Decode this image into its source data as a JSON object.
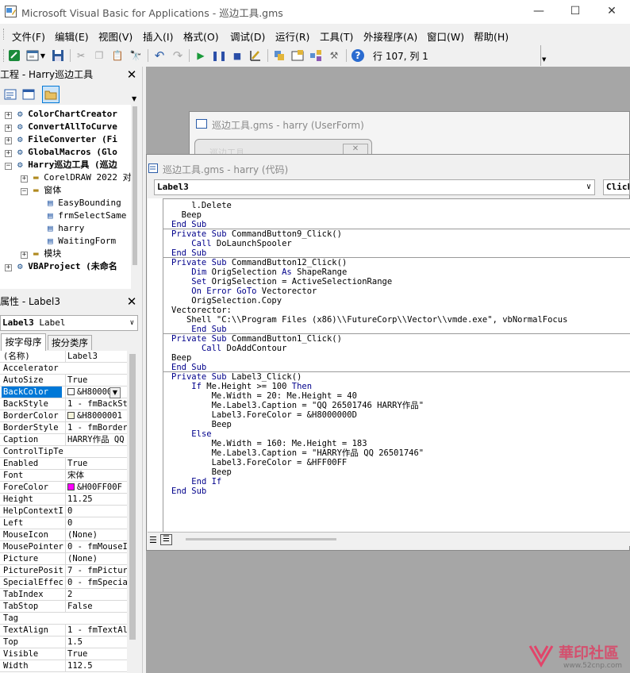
{
  "window": {
    "title": "Microsoft Visual Basic for Applications - 巡边工具.gms",
    "minimize": "—",
    "maximize": "☐",
    "close": "✕"
  },
  "menu": [
    "文件(F)",
    "编辑(E)",
    "视图(V)",
    "插入(I)",
    "格式(O)",
    "调试(D)",
    "运行(R)",
    "工具(T)",
    "外接程序(A)",
    "窗口(W)",
    "帮助(H)"
  ],
  "toolbar": {
    "position": "行 107, 列 1"
  },
  "project_panel": {
    "title": "工程 - Harry巡边工具",
    "items": [
      {
        "text": "ColorChartCreator",
        "bold": true
      },
      {
        "text": "ConvertAllToCurve",
        "bold": true
      },
      {
        "text": "FileConverter (Fi",
        "bold": true
      },
      {
        "text": "GlobalMacros (Glo",
        "bold": true
      },
      {
        "text": "Harry巡边工具 (巡边",
        "bold": true
      },
      {
        "text": "CorelDRAW 2022 对",
        "bold": false
      },
      {
        "text": "窗体",
        "bold": false
      },
      {
        "text": "EasyBounding",
        "bold": false
      },
      {
        "text": "frmSelectSame",
        "bold": false
      },
      {
        "text": "harry",
        "bold": false
      },
      {
        "text": "WaitingForm",
        "bold": false
      },
      {
        "text": "模块",
        "bold": false
      },
      {
        "text": "VBAProject (未命名",
        "bold": true
      }
    ]
  },
  "properties_panel": {
    "title": "属性 - Label3",
    "object": "Label3",
    "object_type": "Label",
    "tabs": [
      "按字母序",
      "按分类序"
    ],
    "rows": [
      {
        "name": "(名称)",
        "value": "Label3"
      },
      {
        "name": "Accelerator",
        "value": ""
      },
      {
        "name": "AutoSize",
        "value": "True"
      },
      {
        "name": "BackColor",
        "value": "&H80000",
        "swatch": "#ffffff"
      },
      {
        "name": "BackStyle",
        "value": "1 - fmBackSt"
      },
      {
        "name": "BorderColor",
        "value": "&H8000001",
        "swatch": "#f5f5dc"
      },
      {
        "name": "BorderStyle",
        "value": "1 - fmBorder"
      },
      {
        "name": "Caption",
        "value": "HARRY作品 QQ"
      },
      {
        "name": "ControlTipTex",
        "value": ""
      },
      {
        "name": "Enabled",
        "value": "True"
      },
      {
        "name": "Font",
        "value": "宋体"
      },
      {
        "name": "ForeColor",
        "value": "&H00FF00F",
        "swatch": "#ff00ff"
      },
      {
        "name": "Height",
        "value": "11.25"
      },
      {
        "name": "HelpContextII",
        "value": "0"
      },
      {
        "name": "Left",
        "value": "0"
      },
      {
        "name": "MouseIcon",
        "value": "(None)"
      },
      {
        "name": "MousePointer",
        "value": "0 - fmMouseI"
      },
      {
        "name": "Picture",
        "value": "(None)"
      },
      {
        "name": "PicturePositi",
        "value": "7 - fmPictur"
      },
      {
        "name": "SpecialEffect",
        "value": "0 - fmSpecia"
      },
      {
        "name": "TabIndex",
        "value": "2"
      },
      {
        "name": "TabStop",
        "value": "False"
      },
      {
        "name": "Tag",
        "value": ""
      },
      {
        "name": "TextAlign",
        "value": "1 - fmTextAl"
      },
      {
        "name": "Top",
        "value": "1.5"
      },
      {
        "name": "Visible",
        "value": "True"
      },
      {
        "name": "Width",
        "value": "112.5"
      }
    ]
  },
  "userform_window": {
    "title": "巡边工具.gms - harry (UserForm)",
    "inner_caption": "巡边工具"
  },
  "code_window": {
    "title": "巡边工具.gms - harry (代码)",
    "object_dropdown": "Label3",
    "proc_dropdown": "Click",
    "lines": [
      "    l.Delete",
      "  Beep",
      "End Sub",
      "Private Sub CommandButton9_Click()",
      "    Call DoLaunchSpooler",
      "End Sub",
      "Private Sub CommandButton12_Click()",
      "    Dim OrigSelection As ShapeRange",
      "    Set OrigSelection = ActiveSelectionRange",
      "    On Error GoTo Vectorector",
      "    OrigSelection.Copy",
      "Vectorector:",
      "   Shell \"C:\\\\Program Files (x86)\\\\FutureCorp\\\\Vector\\\\vmde.exe\", vbNormalFocus",
      "    End Sub",
      "Private Sub CommandButton1_Click()",
      "      Call DoAddContour",
      "Beep",
      "End Sub",
      "Private Sub Label3_Click()",
      "    If Me.Height >= 100 Then",
      "        Me.Width = 20: Me.Height = 40",
      "        Me.Label3.Caption = \"QQ 26501746 HARRY作品\"",
      "        Label3.ForeColor = &H8000000D",
      "        Beep",
      "    Else",
      "        Me.Width = 160: Me.Height = 183",
      "        Me.Label3.Caption = \"HARRY作品 QQ 26501746\"",
      "        Label3.ForeColor = &HFF00FF",
      "        Beep",
      "    End If",
      "End Sub"
    ]
  },
  "watermark": {
    "site": "華印社區",
    "url": "www.52cnp.com"
  }
}
